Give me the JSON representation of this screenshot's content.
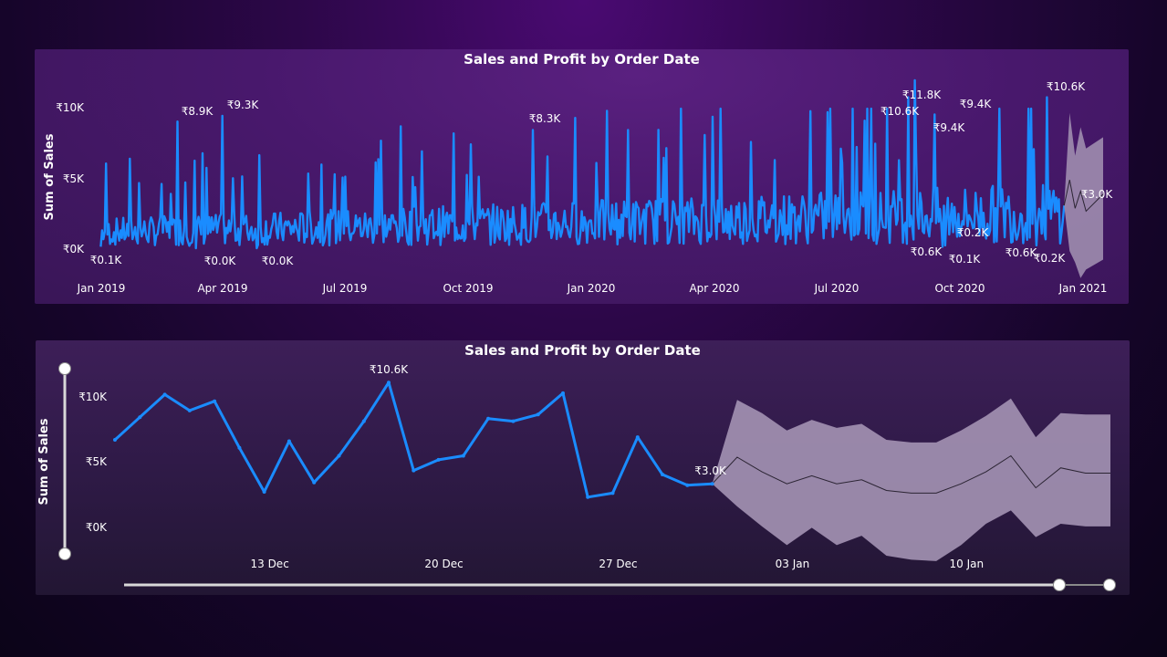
{
  "colors": {
    "line": "#1a8cff",
    "forecast_band": "#a494b4",
    "forecast_line": "#2b2433",
    "text": "#ffffff",
    "slider": "#d8d8d8"
  },
  "top_chart": {
    "title": "Sales and Profit by Order Date",
    "ylabel": "Sum of Sales",
    "yticks": [
      "₹10K",
      "₹5K",
      "₹0K"
    ],
    "xticks": [
      "Jan 2019",
      "Apr 2019",
      "Jul 2019",
      "Oct 2019",
      "Jan 2020",
      "Apr 2020",
      "Jul 2020",
      "Oct 2020",
      "Jan 2021"
    ],
    "annotations": [
      "₹8.9K",
      "₹9.3K",
      "₹8.3K",
      "₹10.6K",
      "₹11.8K",
      "₹9.4K",
      "₹9.4K",
      "₹10.6K",
      "₹3.0K",
      "₹0.1K",
      "₹0.0K",
      "₹0.0K",
      "₹0.6K",
      "₹0.2K",
      "₹0.1K",
      "₹0.6K",
      "₹0.2K"
    ]
  },
  "bottom_chart": {
    "title": "Sales and Profit by Order Date",
    "ylabel": "Sum of Sales",
    "yticks": [
      "₹10K",
      "₹5K",
      "₹0K"
    ],
    "xticks": [
      "13 Dec",
      "20 Dec",
      "27 Dec",
      "03 Jan",
      "10 Jan"
    ],
    "annotations": [
      "₹10.6K",
      "₹3.0K"
    ]
  },
  "chart_data": [
    {
      "type": "line",
      "title": "Sales and Profit by Order Date",
      "ylabel": "Sum of Sales",
      "ylim": [
        0,
        12000
      ],
      "x_range": [
        "2019-01-01",
        "2021-01-15"
      ],
      "series": [
        {
          "name": "Sum of Sales",
          "points": [
            {
              "x": "2019-01-02",
              "y": 100
            },
            {
              "x": "2019-03-01",
              "y": 8900
            },
            {
              "x": "2019-03-15",
              "y": 0
            },
            {
              "x": "2019-04-04",
              "y": 9300
            },
            {
              "x": "2019-04-30",
              "y": 0
            },
            {
              "x": "2019-11-25",
              "y": 8300
            },
            {
              "x": "2020-09-04",
              "y": 10600
            },
            {
              "x": "2020-09-09",
              "y": 11800
            },
            {
              "x": "2020-09-08",
              "y": 600
            },
            {
              "x": "2020-09-24",
              "y": 9400
            },
            {
              "x": "2020-09-30",
              "y": 9400
            },
            {
              "x": "2020-10-02",
              "y": 200
            },
            {
              "x": "2020-09-30",
              "y": 100
            },
            {
              "x": "2020-11-25",
              "y": 600
            },
            {
              "x": "2020-12-18",
              "y": 10600
            },
            {
              "x": "2020-12-10",
              "y": 200
            },
            {
              "x": "2020-12-31",
              "y": 3000
            }
          ]
        }
      ]
    },
    {
      "type": "line",
      "title": "Sales and Profit by Order Date",
      "ylabel": "Sum of Sales",
      "ylim": [
        0,
        12000
      ],
      "categories": [
        "07 Dec",
        "08 Dec",
        "09 Dec",
        "10 Dec",
        "11 Dec",
        "12 Dec",
        "13 Dec",
        "14 Dec",
        "15 Dec",
        "16 Dec",
        "17 Dec",
        "18 Dec",
        "19 Dec",
        "20 Dec",
        "21 Dec",
        "22 Dec",
        "23 Dec",
        "24 Dec",
        "25 Dec",
        "26 Dec",
        "27 Dec",
        "28 Dec",
        "29 Dec",
        "30 Dec",
        "31 Dec",
        "01 Jan",
        "02 Jan",
        "03 Jan",
        "04 Jan",
        "05 Jan",
        "06 Jan",
        "07 Jan",
        "08 Jan",
        "09 Jan",
        "10 Jan",
        "11 Jan",
        "12 Jan",
        "13 Jan",
        "14 Jan",
        "15 Jan",
        "16 Jan"
      ],
      "series": [
        {
          "name": "Sum of Sales",
          "values": [
            6300,
            8000,
            9700,
            8500,
            9200,
            5700,
            2400,
            6200,
            3100,
            5100,
            7700,
            10600,
            4000,
            4800,
            5100,
            7900,
            7700,
            8200,
            9800,
            2000,
            2300,
            6500,
            3700,
            2900,
            3000,
            null,
            null,
            null,
            null,
            null,
            null,
            null,
            null,
            null,
            null,
            null,
            null,
            null,
            null,
            null,
            null
          ]
        },
        {
          "name": "Forecast",
          "values": [
            null,
            null,
            null,
            null,
            null,
            null,
            null,
            null,
            null,
            null,
            null,
            null,
            null,
            null,
            null,
            null,
            null,
            null,
            null,
            null,
            null,
            null,
            null,
            null,
            3000,
            5000,
            3900,
            3000,
            3600,
            3000,
            3300,
            2500,
            2300,
            2300,
            3000,
            3900,
            5100,
            2700,
            4200,
            3800,
            3800
          ]
        },
        {
          "name": "Forecast upper",
          "values": [
            null,
            null,
            null,
            null,
            null,
            null,
            null,
            null,
            null,
            null,
            null,
            null,
            null,
            null,
            null,
            null,
            null,
            null,
            null,
            null,
            null,
            null,
            null,
            null,
            3000,
            9300,
            8300,
            7000,
            7800,
            7200,
            7500,
            6300,
            6100,
            6100,
            7000,
            8100,
            9400,
            6500,
            8300,
            8200,
            8200
          ]
        },
        {
          "name": "Forecast lower",
          "values": [
            null,
            null,
            null,
            null,
            null,
            null,
            null,
            null,
            null,
            null,
            null,
            null,
            null,
            null,
            null,
            null,
            null,
            null,
            null,
            null,
            null,
            null,
            null,
            null,
            3000,
            1300,
            -200,
            -1600,
            -300,
            -1600,
            -900,
            -2400,
            -2700,
            -2800,
            -1600,
            0,
            1000,
            -1000,
            0,
            -200,
            -200
          ]
        }
      ]
    }
  ]
}
